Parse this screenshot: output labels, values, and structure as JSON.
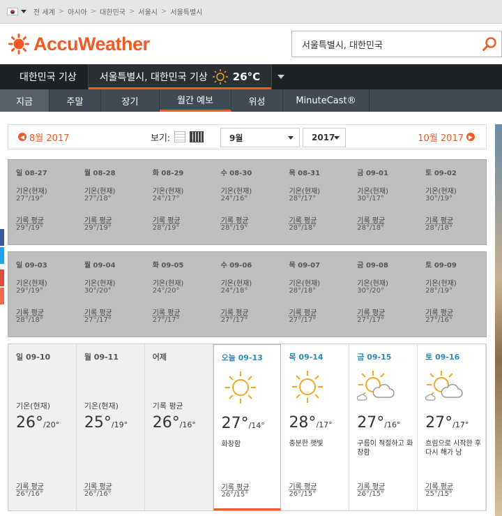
{
  "topbar": {
    "crumbs": [
      "전 세계",
      "아시아",
      "대한민국",
      "서울시",
      "서울특별시"
    ],
    "separator": ">"
  },
  "header": {
    "brand": "AccuWeather",
    "search_value": "서울특별시, 대한민국",
    "brand_color": "#f15a22"
  },
  "nav1": {
    "country": "대한민국 기상",
    "location": "서울특별시, 대한민국 기상",
    "temp": "26°C"
  },
  "nav2": {
    "tabs": [
      "지금",
      "주말",
      "장기",
      "월간 예보",
      "위성",
      "MinuteCast®"
    ],
    "active": "월간 예보"
  },
  "monthbar": {
    "prev": "8월 2017",
    "next": "10월 2017",
    "view_label": "보기:",
    "month_select": "9월",
    "year_select": "2017"
  },
  "weeks": [
    {
      "type": "past",
      "days": [
        {
          "date": "일 08-27",
          "label": "기온(현재)",
          "value": "27°/19°",
          "avg_label": "기록 평균",
          "avg": "29°/19°"
        },
        {
          "date": "월 08-28",
          "label": "기온(현재)",
          "value": "27°/18°",
          "avg_label": "기록 평균",
          "avg": "29°/19°"
        },
        {
          "date": "화 08-29",
          "label": "기온(현재)",
          "value": "24°/17°",
          "avg_label": "기록 평균",
          "avg": "28°/19°"
        },
        {
          "date": "수 08-30",
          "label": "기온(현재)",
          "value": "24°/16°",
          "avg_label": "기록 평균",
          "avg": "28°/19°"
        },
        {
          "date": "목 08-31",
          "label": "기온(현재)",
          "value": "28°/17°",
          "avg_label": "기록 평균",
          "avg": "28°/18°"
        },
        {
          "date": "금 09-01",
          "label": "기온(현재)",
          "value": "30°/17°",
          "avg_label": "기록 평균",
          "avg": "28°/18°"
        },
        {
          "date": "토 09-02",
          "label": "기온(현재)",
          "value": "30°/19°",
          "avg_label": "기록 평균",
          "avg": "28°/18°"
        }
      ]
    },
    {
      "type": "past",
      "days": [
        {
          "date": "일 09-03",
          "label": "기온(현재)",
          "value": "29°/19°",
          "avg_label": "기록 평균",
          "avg": "28°/18°"
        },
        {
          "date": "월 09-04",
          "label": "기온(현재)",
          "value": "30°/20°",
          "avg_label": "기록 평균",
          "avg": "27°/17°"
        },
        {
          "date": "화 09-05",
          "label": "기온(현재)",
          "value": "24°/20°",
          "avg_label": "기록 평균",
          "avg": "27°/17°"
        },
        {
          "date": "수 09-06",
          "label": "기온(현재)",
          "value": "24°/18°",
          "avg_label": "기록 평균",
          "avg": "27°/17°"
        },
        {
          "date": "목 09-07",
          "label": "기온(현재)",
          "value": "28°/18°",
          "avg_label": "기록 평균",
          "avg": "27°/17°"
        },
        {
          "date": "금 09-08",
          "label": "기온(현재)",
          "value": "30°/20°",
          "avg_label": "기록 평균",
          "avg": "27°/17°"
        },
        {
          "date": "토 09-09",
          "label": "기온(현재)",
          "value": "28°/19°",
          "avg_label": "기록 평균",
          "avg": "27°/16°"
        }
      ]
    }
  ],
  "current_week": [
    {
      "date": "일 09-10",
      "label": "기온(현재)",
      "hi": "26°",
      "lo": "/20°",
      "desc": "",
      "avg_label": "기록 평균",
      "avg": "26°/16°",
      "kind": "past"
    },
    {
      "date": "월 09-11",
      "label": "기온(현재)",
      "hi": "25°",
      "lo": "/19°",
      "desc": "",
      "avg_label": "기록 평균",
      "avg": "26°/16°",
      "kind": "past"
    },
    {
      "date": "어제",
      "label": "기록 평균",
      "hi": "26°",
      "lo": "/16°",
      "desc": "",
      "avg_label": "",
      "avg": "",
      "kind": "past"
    },
    {
      "date": "오늘 09-13",
      "label": "",
      "hi": "27°",
      "lo": "/14°",
      "desc": "화창함",
      "avg_label": "기록 평균",
      "avg": "26°/15°",
      "kind": "today",
      "icon": "sun-icon"
    },
    {
      "date": "목 09-14",
      "label": "",
      "hi": "28°",
      "lo": "/17°",
      "desc": "충분한 햇빛",
      "avg_label": "기록 평균",
      "avg": "26°/15°",
      "kind": "future",
      "icon": "sun-icon"
    },
    {
      "date": "금 09-15",
      "label": "",
      "hi": "27°",
      "lo": "/16°",
      "desc": "구름이 적절하고 화창함",
      "avg_label": "기록 평균",
      "avg": "26°/15°",
      "kind": "future",
      "icon": "partly-cloudy-icon"
    },
    {
      "date": "토 09-16",
      "label": "",
      "hi": "27°",
      "lo": "/17°",
      "desc": "흐림으로 시작한 후 다시 해가 남",
      "avg_label": "기록 평균",
      "avg": "25°/15°",
      "kind": "future",
      "icon": "partly-cloudy-icon"
    }
  ]
}
